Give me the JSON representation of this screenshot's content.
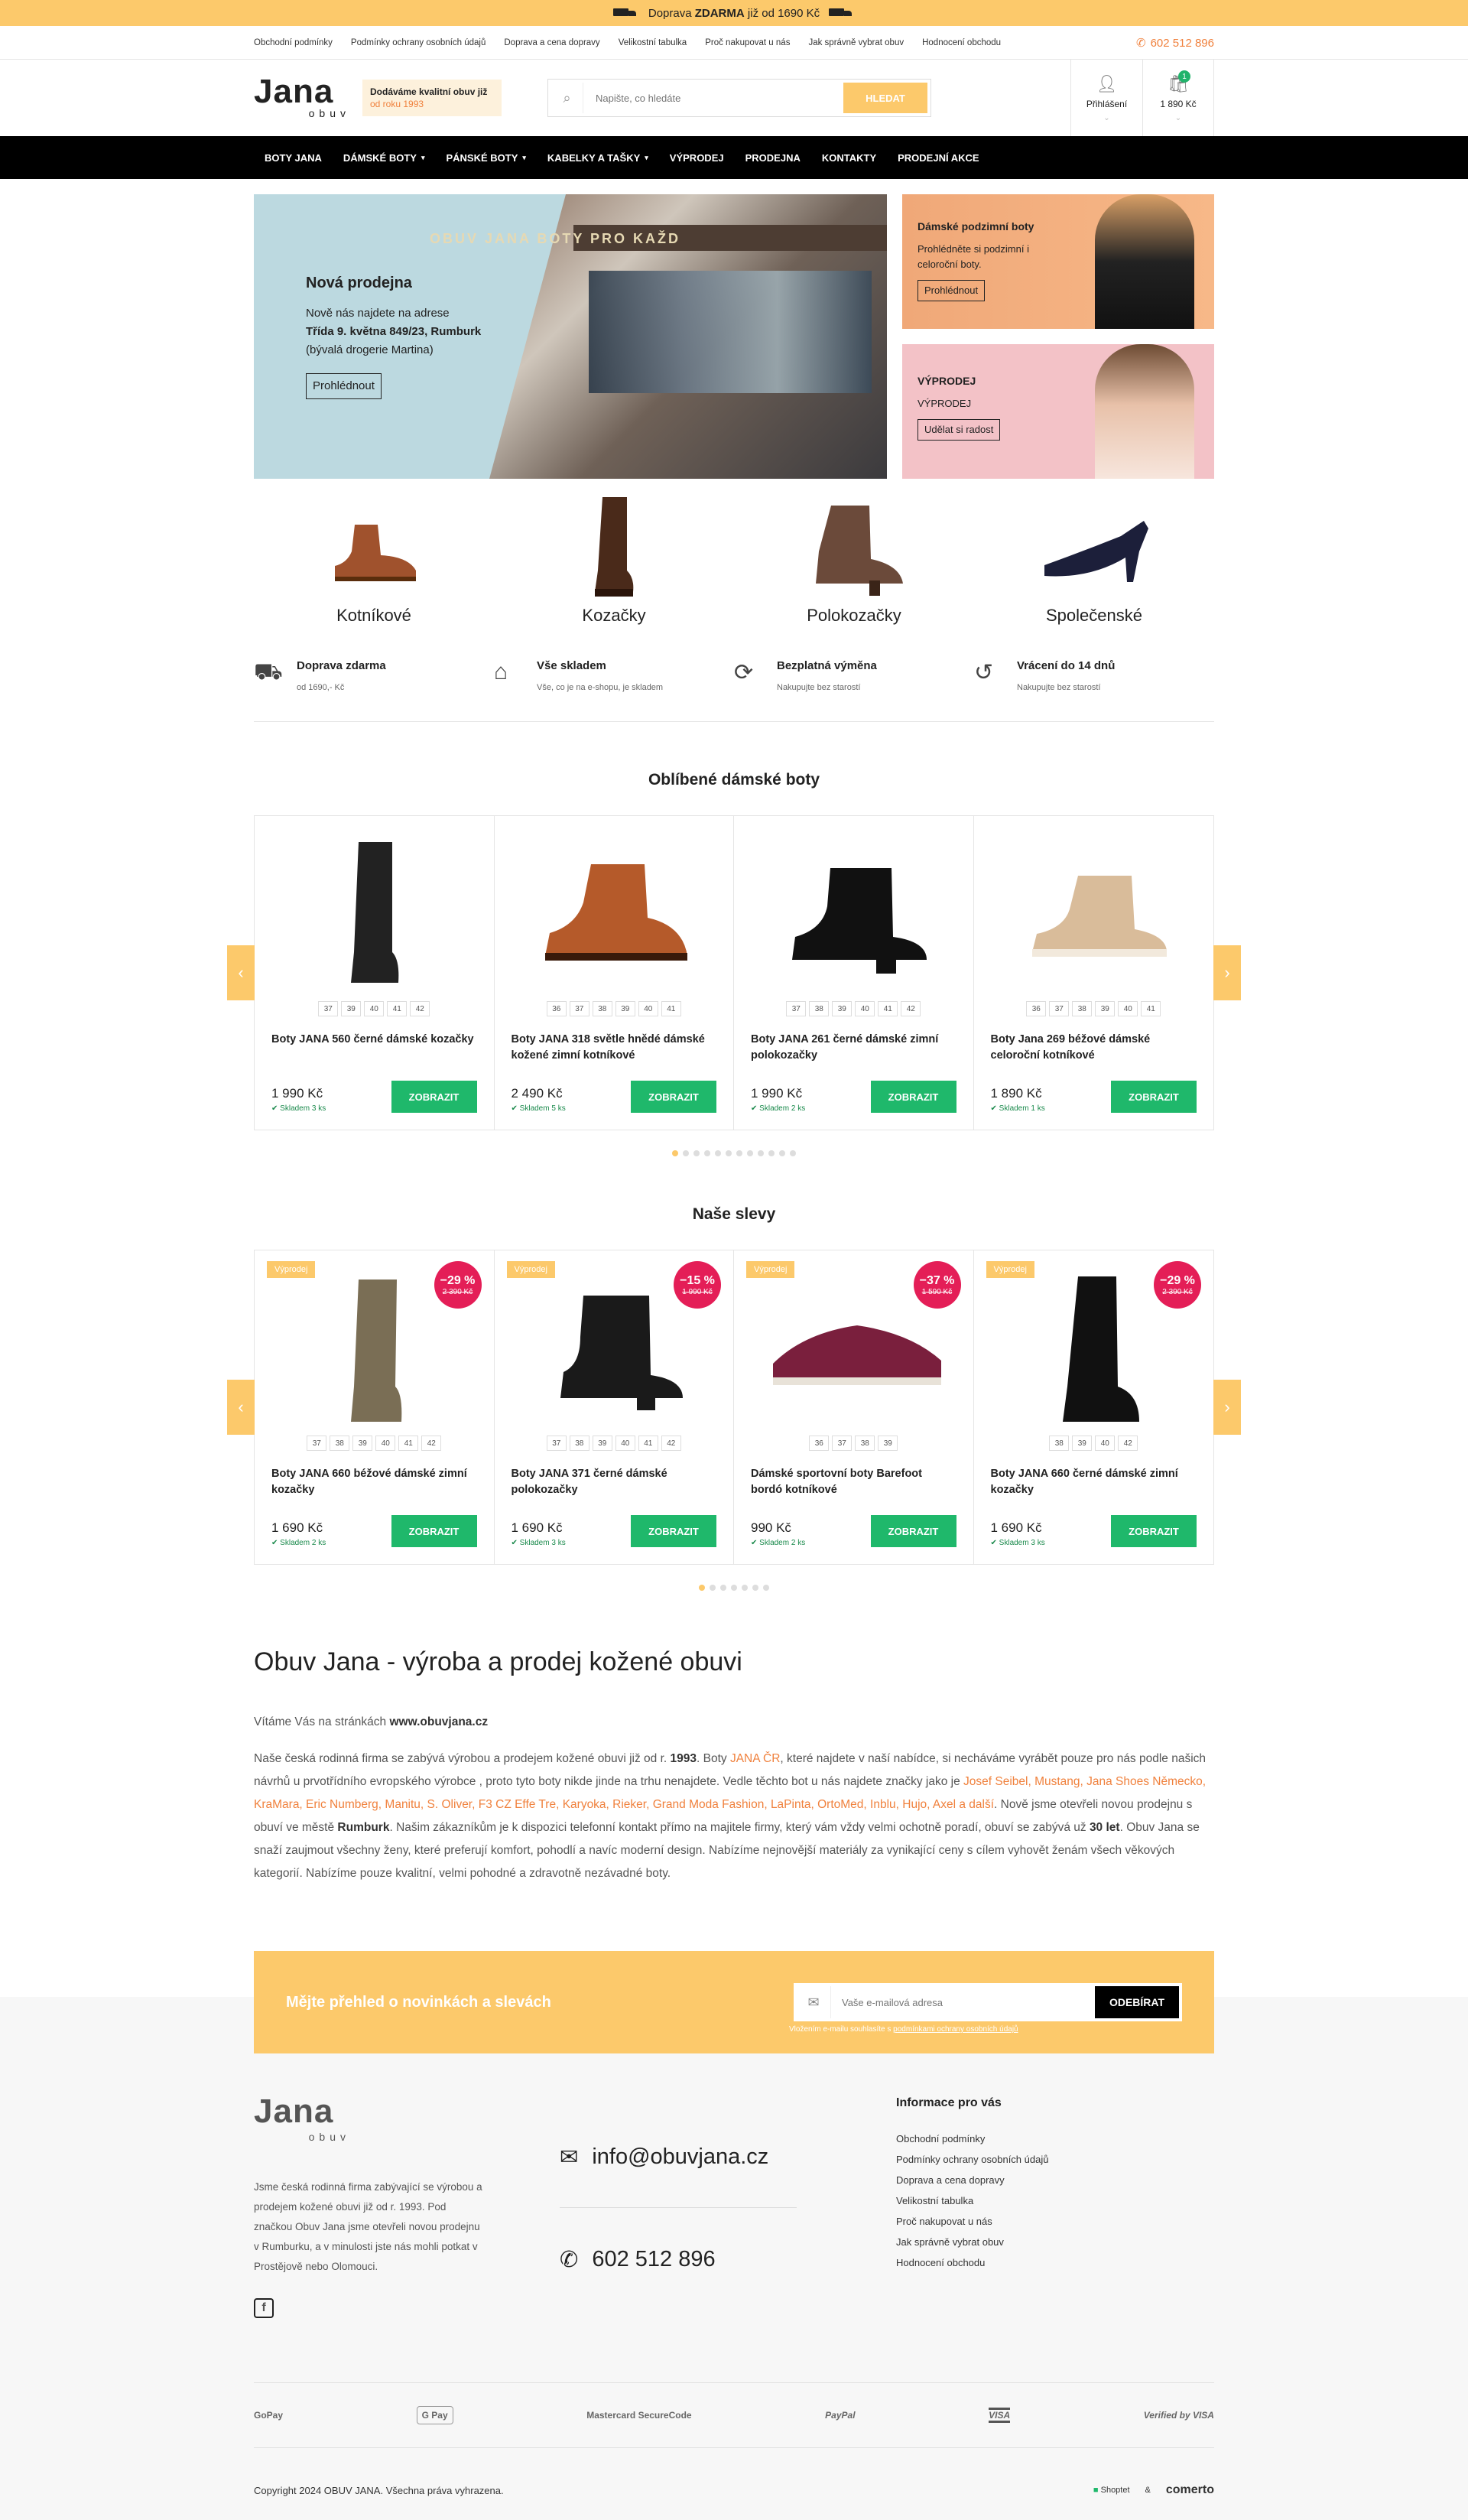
{
  "topbar": {
    "text_pre": "Doprava ",
    "text_bold": "ZDARMA",
    "text_post": " již od 1690 Kč"
  },
  "toplinks": {
    "items": [
      "Obchodní podmínky",
      "Podmínky ochrany osobních údajů",
      "Doprava a cena dopravy",
      "Velikostní tabulka",
      "Proč nakupovat u nás",
      "Jak správně vybrat obuv",
      "Hodnocení obchodu"
    ],
    "phone": "602 512 896"
  },
  "header": {
    "logo_big": "Jana",
    "logo_small": "obuv",
    "slogan_line": "Dodáváme kvalitní obuv již",
    "slogan_since": "od roku 1993",
    "search_placeholder": "Napište, co hledáte",
    "search_button": "HLEDAT",
    "login_label": "Přihlášení",
    "cart_label": "1 890 Kč",
    "cart_count": "1"
  },
  "nav": [
    "BOTY JANA",
    "DÁMSKÉ BOTY",
    "PÁNSKÉ BOTY",
    "KABELKY A TAŠKY",
    "VÝPRODEJ",
    "PRODEJNA",
    "KONTAKTY",
    "PRODEJNÍ AKCE"
  ],
  "banner_main": {
    "sign": "OBUV JANA  BOTY PRO KAŽD",
    "title": "Nová prodejna",
    "line1": "Nově nás najdete na adrese",
    "line2": "Třída 9. května 849/23, Rumburk",
    "line3": "(bývalá drogerie Martina)",
    "button": "Prohlédnout"
  },
  "banner_side1": {
    "title": "Dámské podzimní boty",
    "text": "Prohlédněte si podzimní i celoroční boty.",
    "button": "Prohlédnout"
  },
  "banner_side2": {
    "title": "VÝPRODEJ",
    "text": "VÝPRODEJ",
    "button": "Udělat si radost"
  },
  "categories": [
    {
      "label": "Kotníkové"
    },
    {
      "label": "Kozačky"
    },
    {
      "label": "Polokozačky"
    },
    {
      "label": "Společenské"
    }
  ],
  "benefits": [
    {
      "title": "Doprava zdarma",
      "sub": "od 1690,- Kč",
      "icon": "truck-icon"
    },
    {
      "title": "Vše skladem",
      "sub": "Vše, co je na e-shopu, je skladem",
      "icon": "warehouse-icon"
    },
    {
      "title": "Bezplatná výměna",
      "sub": "Nakupujte bez starostí",
      "icon": "exchange-icon"
    },
    {
      "title": "Vrácení do 14 dnů",
      "sub": "Nakupujte bez starostí",
      "icon": "return-icon"
    }
  ],
  "popular": {
    "title": "Oblíbené dámské boty",
    "button": "ZOBRAZIT",
    "products": [
      {
        "name": "Boty JANA 560 černé dámské kozačky",
        "price": "1 990 Kč",
        "stock": "Skladem 3 ks",
        "sizes": [
          "37",
          "39",
          "40",
          "41",
          "42"
        ]
      },
      {
        "name": "Boty JANA 318 světle hnědé dámské kožené zimní kotníkové",
        "price": "2 490 Kč",
        "stock": "Skladem 5 ks",
        "sizes": [
          "36",
          "37",
          "38",
          "39",
          "40",
          "41"
        ]
      },
      {
        "name": "Boty JANA 261 černé dámské zimní polokozačky",
        "price": "1 990 Kč",
        "stock": "Skladem 2 ks",
        "sizes": [
          "37",
          "38",
          "39",
          "40",
          "41",
          "42"
        ]
      },
      {
        "name": "Boty Jana 269 béžové dámské celoroční kotníkové",
        "price": "1 890 Kč",
        "stock": "Skladem 1 ks",
        "sizes": [
          "36",
          "37",
          "38",
          "39",
          "40",
          "41"
        ]
      }
    ]
  },
  "sale": {
    "title": "Naše slevy",
    "tag": "Výprodej",
    "button": "ZOBRAZIT",
    "products": [
      {
        "name": "Boty JANA 660 béžové dámské zimní kozačky",
        "price": "1 690 Kč",
        "old": "2 390 Kč",
        "disc": "−29 %",
        "stock": "Skladem 2 ks",
        "sizes": [
          "37",
          "38",
          "39",
          "40",
          "41",
          "42"
        ]
      },
      {
        "name": "Boty JANA 371 černé dámské polokozačky",
        "price": "1 690 Kč",
        "old": "1 990 Kč",
        "disc": "−15 %",
        "stock": "Skladem 3 ks",
        "sizes": [
          "37",
          "38",
          "39",
          "40",
          "41",
          "42"
        ]
      },
      {
        "name": "Dámské sportovní boty Barefoot bordó kotníkové",
        "price": "990 Kč",
        "old": "1 590 Kč",
        "disc": "−37 %",
        "stock": "Skladem 2 ks",
        "sizes": [
          "36",
          "37",
          "38",
          "39"
        ]
      },
      {
        "name": "Boty JANA 660 černé dámské zimní kozačky",
        "price": "1 690 Kč",
        "old": "2 390 Kč",
        "disc": "−29 %",
        "stock": "Skladem 3 ks",
        "sizes": [
          "38",
          "39",
          "40",
          "42"
        ]
      }
    ]
  },
  "about": {
    "title": "Obuv Jana - výroba a prodej kožené obuvi",
    "welcome_pre": "Vítáme Vás na stránkách ",
    "welcome_site": "www.obuvjana.cz",
    "p1a": "Naše česká rodinná firma se zabývá výrobou a prodejem kožené obuvi již od r. ",
    "p1year": "1993",
    "p1b": ". Boty ",
    "p1link": "JANA ČR",
    "p1c": ", které najdete v naší nabídce, si necháváme vyrábět pouze pro nás podle našich návrhů u prvotřídního evropského výrobce , proto tyto boty nikde jinde na trhu nenajdete. Vedle těchto bot u nás najdete značky  jako je  ",
    "brands": "Josef Seibel, Mustang, Jana Shoes Německo, KraMara, Eric Numberg, Manitu, S. Oliver, F3 CZ Effe Tre, Karyoka, Rieker, Grand Moda Fashion, LaPinta, OrtoMed, Inblu, Hujo, Axel a další",
    "p1d": ".  Nově jsme otevřeli novou prodejnu s obuví ve městě ",
    "town": "Rumburk",
    "p1e": ". Našim zákazníkům je k dispozici telefonní kontakt přímo na majitele firmy, který vám vždy velmi ochotně poradí, obuví se zabývá už ",
    "years": "30 let",
    "p1f": ". Obuv Jana se snaží zaujmout všechny ženy, které preferují komfort, pohodlí a navíc moderní design. Nabízíme nejnovější materiály za vynikající ceny s cílem vyhovět ženám všech věkových kategorií. Nabízíme pouze kvalitní, velmi pohodné a zdravotně nezávadné boty."
  },
  "newsletter": {
    "title": "Mějte přehled o novinkách a slevách",
    "placeholder": "Vaše e-mailová adresa",
    "button": "ODEBÍRAT",
    "note_pre": "Vložením e-mailu souhlasíte s ",
    "note_link": "podmínkami ochrany osobních údajů"
  },
  "footer": {
    "about": "Jsme česká rodinná firma zabývající se výrobou a prodejem kožené obuvi již od r. 1993. Pod značkou Obuv Jana jsme otevřeli novou prodejnu v Rumburku, a v minulosti jste nás mohli potkat v Prostějově nebo Olomouci.",
    "email": "info@obuvjana.cz",
    "phone": "602 512 896",
    "info_title": "Informace pro vás",
    "info_links": [
      "Obchodní podmínky",
      "Podmínky ochrany osobních údajů",
      "Doprava a cena dopravy",
      "Velikostní tabulka",
      "Proč nakupovat u nás",
      "Jak správně vybrat obuv",
      "Hodnocení obchodu"
    ]
  },
  "payments": [
    "GoPay",
    "G Pay",
    "Mastercard SecureCode",
    "PayPal",
    "VISA",
    "Verified by VISA"
  ],
  "copyright": {
    "text": "Copyright 2024 OBUV JANA. Všechna práva vyhrazena.",
    "shoptet": "Shoptet",
    "amp": "&",
    "comerto": "comerto"
  },
  "colors": {
    "accent": "#fcc96b",
    "orange": "#f0813d",
    "green": "#1fb86b",
    "discount": "#e41e57"
  }
}
